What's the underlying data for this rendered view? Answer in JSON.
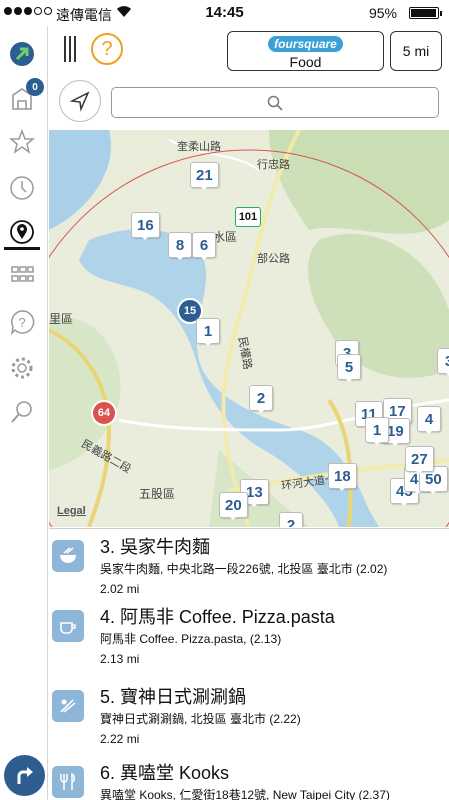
{
  "status_bar": {
    "carrier": "遠傳電信",
    "time": "14:45",
    "battery": "95%",
    "battery_level": 0.95
  },
  "header": {
    "provider_logo": "foursquare",
    "category": "Food",
    "radius": "5 mi",
    "help": "?",
    "search_placeholder": ""
  },
  "sidebar": {
    "badge_count": "0"
  },
  "map": {
    "labels": {
      "l1": "奎柔山路",
      "l2": "行忠路",
      "l3": "水區",
      "l4": "部公路",
      "l5": "民權路",
      "l6": "环河大道一段",
      "l7": "民義路二段",
      "l8": "五股區",
      "l9": "里區",
      "l10": "Legal"
    },
    "road_numbers": {
      "r101": "101",
      "r15": "15",
      "r64": "64"
    },
    "pins": [
      "21",
      "16",
      "8",
      "6",
      "1",
      "3",
      "5",
      "2",
      "11",
      "17",
      "19",
      "1",
      "18",
      "13",
      "20",
      "2",
      "45",
      "43",
      "50",
      "4",
      "27",
      "3"
    ]
  },
  "list": [
    {
      "name": "3. 吳家牛肉麵",
      "address": "吳家牛肉麵, 中央北路一段226號, 北投區 臺北市 (2.02)",
      "distance": "2.02 mi",
      "icon": "noodle-bowl-icon"
    },
    {
      "name": "4. 阿馬非 Coffee. Pizza.pasta",
      "address": "阿馬非 Coffee. Pizza.pasta,  (2.13)",
      "distance": "2.13 mi",
      "icon": "coffee-cup-icon"
    },
    {
      "name": "5. 寶神日式涮涮鍋",
      "address": "寶神日式涮涮鍋, 北投區 臺北市 (2.22)",
      "distance": "2.22 mi",
      "icon": "sushi-icon"
    },
    {
      "name": "6. 異嗑堂 Kooks",
      "address": "異嗑堂 Kooks, 仁愛街18巷12號, New Taipei City  (2.37)",
      "distance": "",
      "icon": "fork-knife-icon"
    }
  ],
  "colors": {
    "accent": "#2d5d91",
    "help": "#f0a020",
    "water": "#a9d0e8",
    "park": "#c9deb3",
    "radius_circle": "#d9534f"
  }
}
